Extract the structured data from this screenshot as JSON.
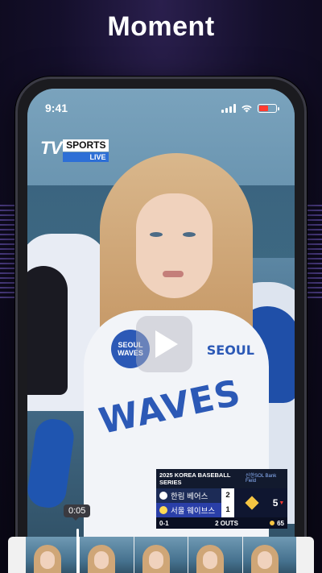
{
  "title": "Moment",
  "status_bar": {
    "time": "9:41",
    "battery_color": "#ff3b30"
  },
  "channel_logo": {
    "brand": "TV",
    "name": "SPORTS",
    "badge": "LIVE"
  },
  "video": {
    "play_icon": "play-icon",
    "jersey_text": "WAVES",
    "jersey_chest_text": "SEOUL",
    "jersey_badge_text": "SEOUL WAVES"
  },
  "scoreboard": {
    "series": "2025 KOREA BASEBALL SERIES",
    "sponsor": "신한SOL Bank Field",
    "teams": [
      {
        "name": "한림 베어스",
        "score": "2"
      },
      {
        "name": "서울 웨이브스",
        "score": "1"
      }
    ],
    "inning": "5",
    "count": "0-1",
    "outs": "2 OUTS",
    "pitch_count": "65"
  },
  "timeline": {
    "current_time": "0:05"
  },
  "colors": {
    "accent_blue": "#2d6fd6",
    "live_badge": "#2d6fd6",
    "base_occupied": "#f5c542"
  }
}
